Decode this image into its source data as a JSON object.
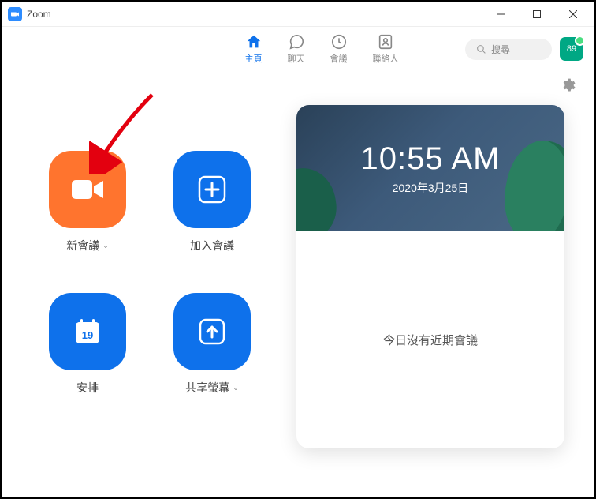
{
  "titlebar": {
    "app_name": "Zoom"
  },
  "nav": {
    "tabs": [
      {
        "label": "主頁"
      },
      {
        "label": "聊天"
      },
      {
        "label": "會議"
      },
      {
        "label": "聯絡人"
      }
    ],
    "search_placeholder": "搜尋",
    "avatar_text": "89"
  },
  "actions": {
    "new_meeting": "新會議",
    "join": "加入會議",
    "schedule": "安排",
    "schedule_day": "19",
    "share_screen": "共享螢幕"
  },
  "card": {
    "time": "10:55 AM",
    "date": "2020年3月25日",
    "no_meetings": "今日沒有近期會議"
  }
}
